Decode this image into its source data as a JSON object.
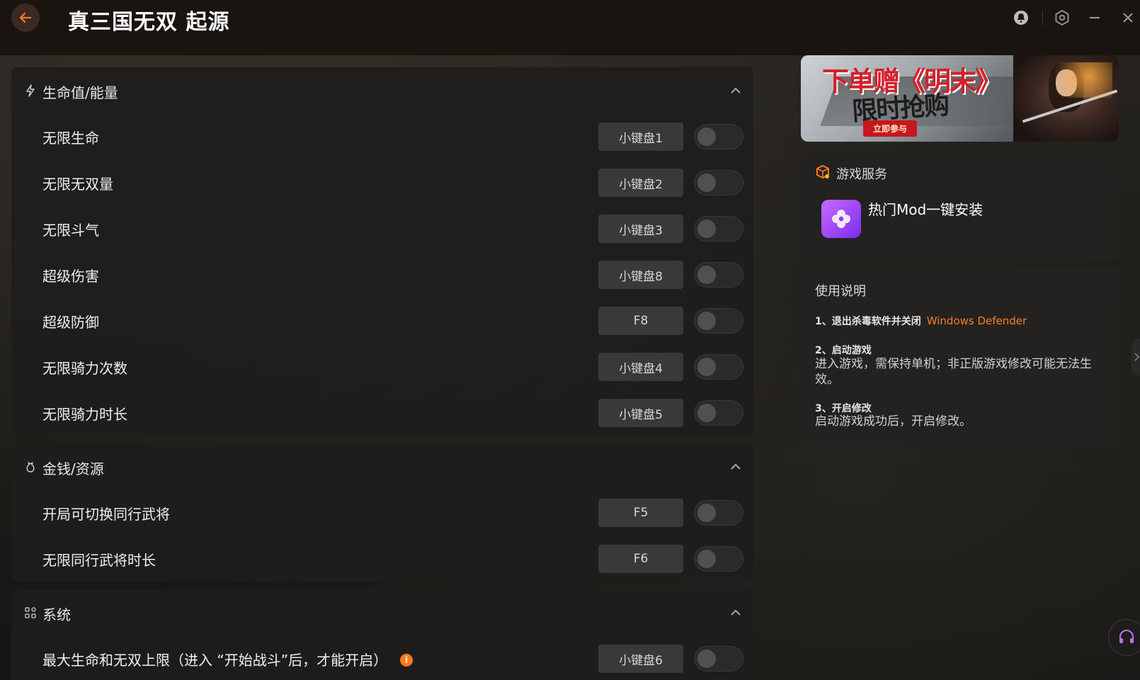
{
  "app": {
    "title": "真三国无双 起源"
  },
  "window_controls": [
    "notification-icon",
    "settings-icon",
    "minimize-icon",
    "close-icon"
  ],
  "sections": [
    {
      "title": "生命值/能量",
      "icon": "lightning-icon",
      "items": [
        {
          "label": "无限生命",
          "key": "小键盘1",
          "enabled": false
        },
        {
          "label": "无限无双量",
          "key": "小键盘2",
          "enabled": false
        },
        {
          "label": "无限斗气",
          "key": "小键盘3",
          "enabled": false
        },
        {
          "label": "超级伤害",
          "key": "小键盘8",
          "enabled": false
        },
        {
          "label": "超级防御",
          "key": "F8",
          "enabled": false
        },
        {
          "label": "无限骑力次数",
          "key": "小键盘4",
          "enabled": false
        },
        {
          "label": "无限骑力时长",
          "key": "小键盘5",
          "enabled": false
        }
      ]
    },
    {
      "title": "金钱/资源",
      "icon": "money-bag-icon",
      "items": [
        {
          "label": "开局可切换同行武将",
          "key": "F5",
          "enabled": false
        },
        {
          "label": "无限同行武将时长",
          "key": "F6",
          "enabled": false
        }
      ]
    },
    {
      "title": "系统",
      "icon": "grid-settings-icon",
      "items": [
        {
          "label": "最大生命和无双上限（进入 “开始战斗”后，才能开启）",
          "key": "小键盘6",
          "enabled": false,
          "info": "i"
        }
      ]
    }
  ],
  "banner": {
    "title": "下单赠《明末》",
    "subtitle": "限时抢购",
    "cta": "立即参与"
  },
  "game_service": {
    "title": "游戏服务",
    "item_label": "热门Mod一键安装"
  },
  "help": {
    "title": "使用说明",
    "steps": [
      {
        "title": "1、退出杀毒软件并关闭",
        "link": "Windows Defender"
      },
      {
        "title": "2、启动游戏",
        "text": "进入游戏，需保持单机；非正版游戏修改可能无法生效。"
      },
      {
        "title": "3、开启修改",
        "text": "启动游戏成功后，开启修改。"
      }
    ]
  },
  "colors": {
    "accent": "#ff7a1a",
    "mod_icon": "#9a3cf5",
    "banner_red": "#d4202a"
  }
}
